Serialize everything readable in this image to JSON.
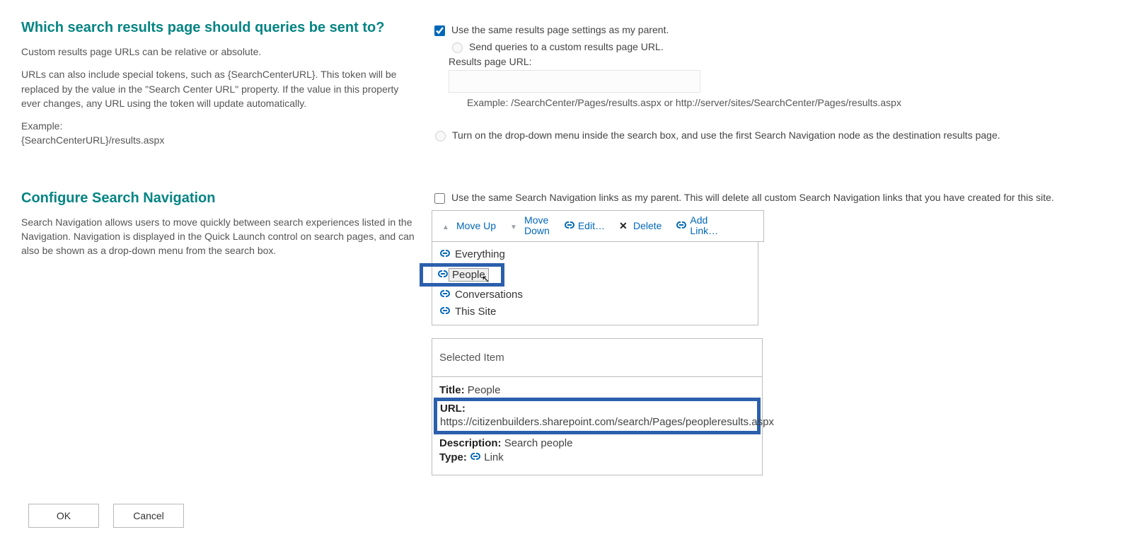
{
  "section1": {
    "title": "Which search results page should queries be sent to?",
    "desc1": "Custom results page URLs can be relative or absolute.",
    "desc2": "URLs can also include special tokens, such as {SearchCenterURL}. This token will be replaced by the value in the \"Search Center URL\" property. If the value in this property ever changes, any URL using the token will update automatically.",
    "desc3a": "Example:",
    "desc3b": "{SearchCenterURL}/results.aspx",
    "opt_parent": "Use the same results page settings as my parent.",
    "opt_custom": "Send queries to a custom results page URL.",
    "url_label": "Results page URL:",
    "url_example": "Example: /SearchCenter/Pages/results.aspx or http://server/sites/SearchCenter/Pages/results.aspx",
    "opt_dropdown": "Turn on the drop-down menu inside the search box, and use the first Search Navigation node as the destination results page."
  },
  "section2": {
    "title": "Configure Search Navigation",
    "desc": "Search Navigation allows users to move quickly between search experiences listed in the Navigation. Navigation is displayed in the Quick Launch control on search pages, and can also be shown as a drop-down menu from the search box.",
    "cb_parent": "Use the same Search Navigation links as my parent. This will delete all custom Search Navigation links that you have created for this site.",
    "toolbar": {
      "moveup": "Move Up",
      "movedown_l1": "Move",
      "movedown_l2": "Down",
      "edit": "Edit…",
      "delete": "Delete",
      "addlink_l1": "Add",
      "addlink_l2": "Link…"
    },
    "items": {
      "everything": "Everything",
      "people": "People",
      "conversations": "Conversations",
      "thissite": "This Site"
    },
    "selected": {
      "header": "Selected Item",
      "title_lbl": "Title:",
      "title_val": "People",
      "url_lbl": "URL:",
      "url_val": "https://citizenbuilders.sharepoint.com/search/Pages/peopleresults.aspx",
      "desc_lbl": "Description:",
      "desc_val": "Search people",
      "type_lbl": "Type:",
      "type_val": "Link"
    }
  },
  "buttons": {
    "ok": "OK",
    "cancel": "Cancel"
  }
}
